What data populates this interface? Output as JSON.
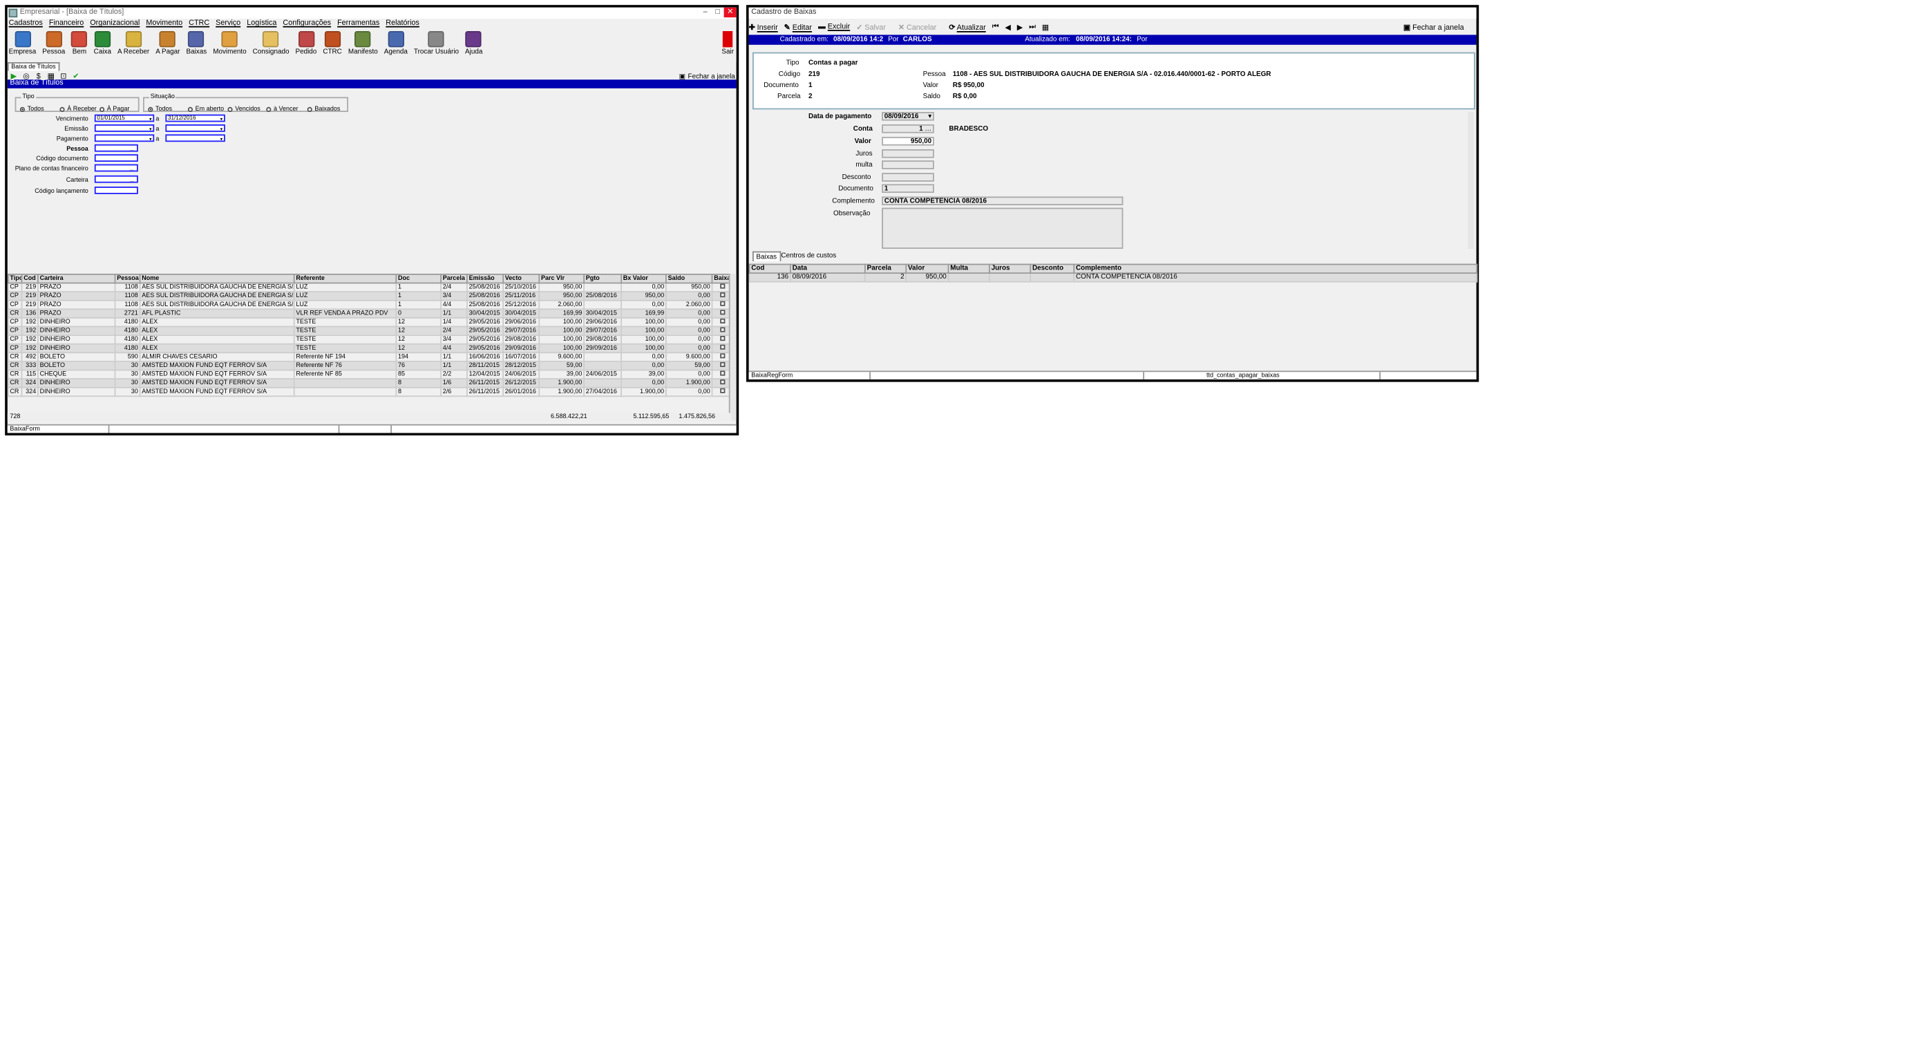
{
  "left": {
    "window_title": "Empresarial - [Baixa de Títulos]",
    "menu": [
      "Cadastros",
      "Financeiro",
      "Organizacional",
      "Movimento",
      "CTRC",
      "Serviço",
      "Logística",
      "Configurações",
      "Ferramentas",
      "Relatórios"
    ],
    "toolbar": [
      {
        "label": "Empresa",
        "color": "#3a77c9"
      },
      {
        "label": "Pessoa",
        "color": "#cc6a2a"
      },
      {
        "label": "Bem",
        "color": "#d24b3b"
      },
      {
        "label": "Caixa",
        "color": "#2d8c3a"
      },
      {
        "label": "A Receber",
        "color": "#d8b340"
      },
      {
        "label": "A Pagar",
        "color": "#c8822e"
      },
      {
        "label": "Baixas",
        "color": "#5566aa"
      },
      {
        "label": "Movimento",
        "color": "#e0a040"
      },
      {
        "label": "Consignado",
        "color": "#e6c060"
      },
      {
        "label": "Pedido",
        "color": "#c04848"
      },
      {
        "label": "CTRC",
        "color": "#c05020"
      },
      {
        "label": "Manifesto",
        "color": "#6a8a40"
      },
      {
        "label": "Agenda",
        "color": "#4a6ab0"
      },
      {
        "label": "Trocar Usuário",
        "color": "#888888"
      },
      {
        "label": "Ajuda",
        "color": "#6a3a8a"
      }
    ],
    "exit_label": "Sair",
    "tab_label": "Baixa de Títulos",
    "close_window": "Fechar a janela",
    "header": "Baixa de Títulos",
    "tipo": {
      "legend": "Tipo",
      "options": [
        "Todos",
        "À Receber",
        "À Pagar"
      ],
      "selected": 0
    },
    "situacao": {
      "legend": "Situação",
      "options": [
        "Todos",
        "Em aberto",
        "Vencidos",
        "à Vencer",
        "Baixados"
      ],
      "selected": 0
    },
    "filters": {
      "vencimento_label": "Vencimento",
      "vencimento_from": "01/01/2015",
      "vencimento_to": "31/12/2016",
      "emissao_label": "Emissão",
      "pagamento_label": "Pagamento",
      "a": "a",
      "pessoa_label": "Pessoa",
      "codigo_doc_label": "Código documento",
      "plano_label": "Plano de contas financeiro",
      "carteira_label": "Carteira",
      "codigo_lanc_label": "Código lançamento",
      "ellipsis": "..."
    },
    "table": {
      "headers": [
        "Tipo",
        "Cod",
        "Carteira",
        "Pessoa",
        "Nome",
        "Referente",
        "Doc",
        "Parcela",
        "Emissão",
        "Vecto",
        "Parc Vlr",
        "Pgto",
        "Bx Valor",
        "Saldo",
        "Baixa"
      ],
      "rows": [
        [
          "CP",
          "219",
          "PRAZO",
          "1108",
          "AES SUL DISTRIBUIDORA GAUCHA DE ENERGIA S/A",
          "LUZ",
          "1",
          "2/4",
          "25/08/2016",
          "25/10/2016",
          "950,00",
          "",
          "0,00",
          "950,00"
        ],
        [
          "CP",
          "219",
          "PRAZO",
          "1108",
          "AES SUL DISTRIBUIDORA GAUCHA DE ENERGIA S/A",
          "LUZ",
          "1",
          "3/4",
          "25/08/2016",
          "25/11/2016",
          "950,00",
          "25/08/2016",
          "950,00",
          "0,00"
        ],
        [
          "CP",
          "219",
          "PRAZO",
          "1108",
          "AES SUL DISTRIBUIDORA GAUCHA DE ENERGIA S/A",
          "LUZ",
          "1",
          "4/4",
          "25/08/2016",
          "25/12/2016",
          "2.060,00",
          "",
          "0,00",
          "2.060,00"
        ],
        [
          "CR",
          "136",
          "PRAZO",
          "2721",
          "AFL PLASTIC",
          "VLR REF VENDA A PRAZO PDV",
          "0",
          "1/1",
          "30/04/2015",
          "30/04/2015",
          "169,99",
          "30/04/2015",
          "169,99",
          "0,00"
        ],
        [
          "CP",
          "192",
          "DINHEIRO",
          "4180",
          "ALEX",
          "TESTE",
          "12",
          "1/4",
          "29/05/2016",
          "29/06/2016",
          "100,00",
          "29/06/2016",
          "100,00",
          "0,00"
        ],
        [
          "CP",
          "192",
          "DINHEIRO",
          "4180",
          "ALEX",
          "TESTE",
          "12",
          "2/4",
          "29/05/2016",
          "29/07/2016",
          "100,00",
          "29/07/2016",
          "100,00",
          "0,00"
        ],
        [
          "CP",
          "192",
          "DINHEIRO",
          "4180",
          "ALEX",
          "TESTE",
          "12",
          "3/4",
          "29/05/2016",
          "29/08/2016",
          "100,00",
          "29/08/2016",
          "100,00",
          "0,00"
        ],
        [
          "CP",
          "192",
          "DINHEIRO",
          "4180",
          "ALEX",
          "TESTE",
          "12",
          "4/4",
          "29/05/2016",
          "29/09/2016",
          "100,00",
          "29/09/2016",
          "100,00",
          "0,00"
        ],
        [
          "CR",
          "492",
          "BOLETO",
          "590",
          "ALMIR CHAVES CESARIO",
          "Referente NF 194",
          "194",
          "1/1",
          "16/06/2016",
          "16/07/2016",
          "9.600,00",
          "",
          "0,00",
          "9.600,00"
        ],
        [
          "CR",
          "333",
          "BOLETO",
          "30",
          "AMSTED MAXION FUND EQT FERROV S/A",
          "Referente NF 76",
          "76",
          "1/1",
          "28/11/2015",
          "28/12/2015",
          "59,00",
          "",
          "0,00",
          "59,00"
        ],
        [
          "CR",
          "115",
          "CHEQUE",
          "30",
          "AMSTED MAXION FUND EQT FERROV S/A",
          "Referente NF 85",
          "85",
          "2/2",
          "12/04/2015",
          "24/06/2015",
          "39,00",
          "24/06/2015",
          "39,00",
          "0,00"
        ],
        [
          "CR",
          "324",
          "DINHEIRO",
          "30",
          "AMSTED MAXION FUND EQT FERROV S/A",
          "",
          "8",
          "1/6",
          "26/11/2015",
          "26/12/2015",
          "1.900,00",
          "",
          "0,00",
          "1.900,00"
        ],
        [
          "CR",
          "324",
          "DINHEIRO",
          "30",
          "AMSTED MAXION FUND EQT FERROV S/A",
          "",
          "8",
          "2/6",
          "26/11/2015",
          "26/01/2016",
          "1.900,00",
          "27/04/2016",
          "1.900,00",
          "0,00"
        ]
      ],
      "count": "728",
      "total_parc": "6.588.422,21",
      "total_bx": "5.112.595,65",
      "total_saldo": "1.475.826,56"
    },
    "status": "BaixaForm"
  },
  "right": {
    "window_title": "Cadastro de Baixas",
    "toolbar": {
      "inserir": "Inserir",
      "editar": "Editar",
      "excluir": "Excluir",
      "salvar": "Salvar",
      "cancelar": "Cancelar",
      "atualizar": "Atualizar",
      "fechar": "Fechar a janela"
    },
    "info": {
      "cad_label": "Cadastrado em:",
      "cad_value": "08/09/2016 14:2",
      "por1": "Por",
      "por1_value": "CARLOS",
      "atu_label": "Atualizado em:",
      "atu_value": "08/09/2016 14:24:",
      "por2": "Por"
    },
    "summary": {
      "tipo_label": "Tipo",
      "tipo": "Contas a pagar",
      "codigo_label": "Código",
      "codigo": "219",
      "documento_label": "Documento",
      "documento": "1",
      "parcela_label": "Parcela",
      "parcela": "2",
      "pessoa_label": "Pessoa",
      "pessoa": "1108 - AES SUL DISTRIBUIDORA GAUCHA DE ENERGIA S/A - 02.016.440/0001-62  -  PORTO ALEGR",
      "valor_label": "Valor",
      "valor": "R$ 950,00",
      "saldo_label": "Saldo",
      "saldo": "R$ 0,00"
    },
    "form": {
      "data_label": "Data de pagamento",
      "data": "08/09/2016",
      "conta_label": "Conta",
      "conta": "1",
      "conta_name": "BRADESCO",
      "valor_label": "Valor",
      "valor": "950,00",
      "juros_label": "Juros",
      "multa_label": "multa",
      "desconto_label": "Desconto",
      "documento_label": "Documento",
      "documento": "1",
      "complemento_label": "Complemento",
      "complemento": "CONTA COMPETENCIA 08/2016",
      "observacao_label": "Observação"
    },
    "tabs": [
      "Baixas",
      "Centros de custos"
    ],
    "grid": {
      "headers": [
        "Cod",
        "Data",
        "Parcela",
        "Valor",
        "Multa",
        "Juros",
        "Desconto",
        "Complemento"
      ],
      "rows": [
        [
          "136",
          "08/09/2016",
          "2",
          "950,00",
          "",
          "",
          "",
          "CONTA COMPETENCIA 08/2016"
        ]
      ]
    },
    "status": [
      "BaixaRegForm",
      "",
      "ttd_contas_apagar_baixas"
    ]
  }
}
